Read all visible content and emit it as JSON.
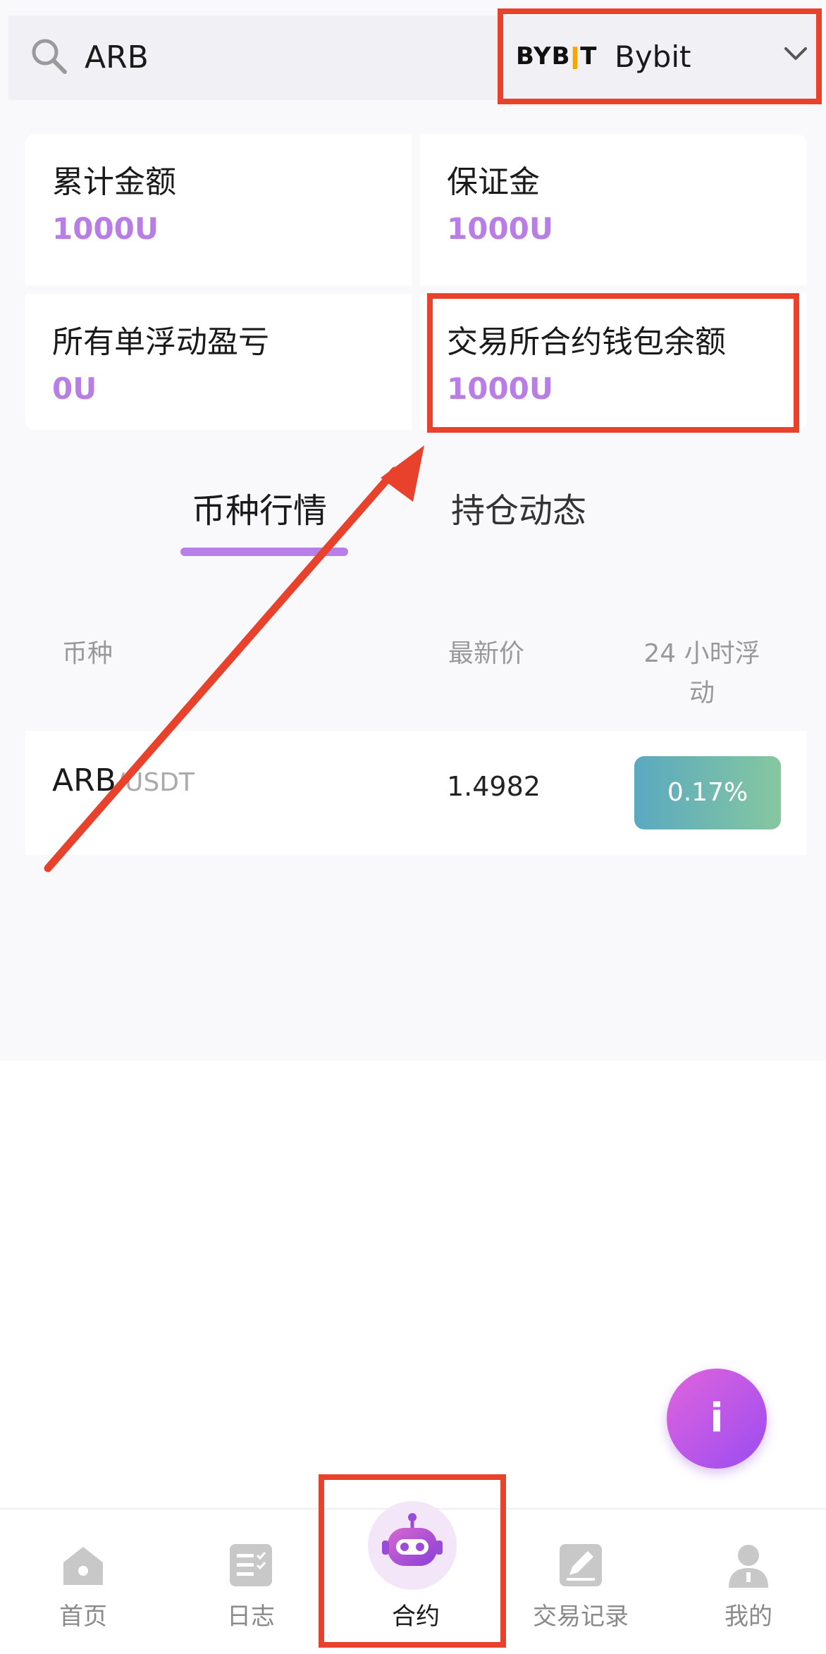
{
  "search": {
    "value": "ARB"
  },
  "exchange": {
    "logo_text_left": "BYB",
    "logo_text_right": "T",
    "name": "Bybit"
  },
  "cards": [
    {
      "label": "累计金额",
      "value": "1000U"
    },
    {
      "label": "保证金",
      "value": "1000U"
    },
    {
      "label": "所有单浮动盈亏",
      "value": "0U"
    },
    {
      "label": "交易所合约钱包余额",
      "value": "1000U"
    }
  ],
  "tabs": [
    {
      "label": "币种行情",
      "active": true
    },
    {
      "label": "持仓动态",
      "active": false
    }
  ],
  "table": {
    "headers": {
      "coin": "币种",
      "price": "最新价",
      "change_line1": "24 小时浮",
      "change_line2": "动"
    },
    "rows": [
      {
        "base": "ARB",
        "quote": "/USDT",
        "price": "1.4982",
        "change": "0.17%"
      }
    ]
  },
  "fab": {
    "label": "i"
  },
  "nav": [
    {
      "label": "首页",
      "icon": "home-icon"
    },
    {
      "label": "日志",
      "icon": "log-icon"
    },
    {
      "label": "合约",
      "icon": "robot-icon",
      "active": true
    },
    {
      "label": "交易记录",
      "icon": "edit-icon"
    },
    {
      "label": "我的",
      "icon": "user-icon"
    }
  ],
  "colors": {
    "accent": "#b780e8",
    "annotation": "#e8412c"
  }
}
